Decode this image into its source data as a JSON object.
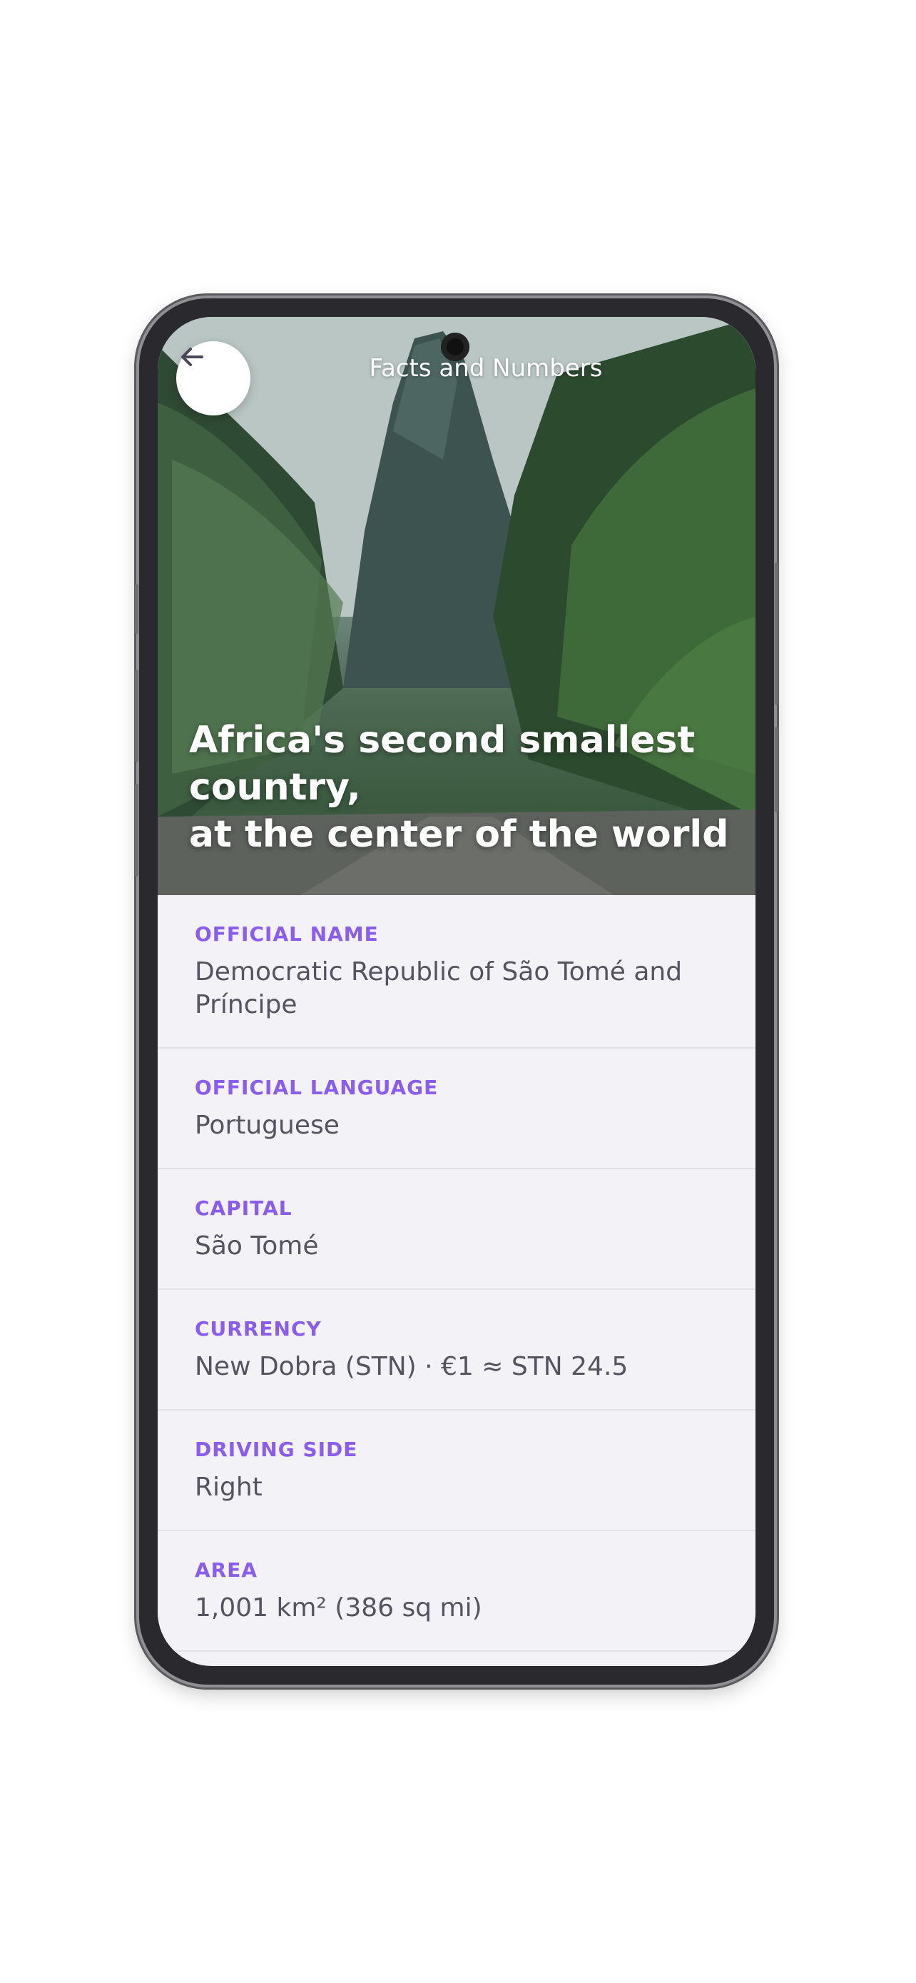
{
  "header": {
    "title": "Facts and Numbers",
    "back_icon": "arrow-left-icon"
  },
  "hero": {
    "tagline": "Africa's second smallest country,\nat the center of the world"
  },
  "facts": [
    {
      "label": "OFFICIAL NAME",
      "value": "Democratic Republic of São Tomé and Príncipe"
    },
    {
      "label": "OFFICIAL LANGUAGE",
      "value": "Portuguese"
    },
    {
      "label": "CAPITAL",
      "value": "São Tomé"
    },
    {
      "label": "CURRENCY",
      "value": "New Dobra (STN) · €1 ≈ STN 24.5"
    },
    {
      "label": "DRIVING SIDE",
      "value": "Right"
    },
    {
      "label": "AREA",
      "value": "1,001 km² (386 sq mi)"
    }
  ],
  "colors": {
    "accent": "#8a5cf0",
    "value_text": "#555360",
    "list_bg": "#f3f2f7"
  }
}
